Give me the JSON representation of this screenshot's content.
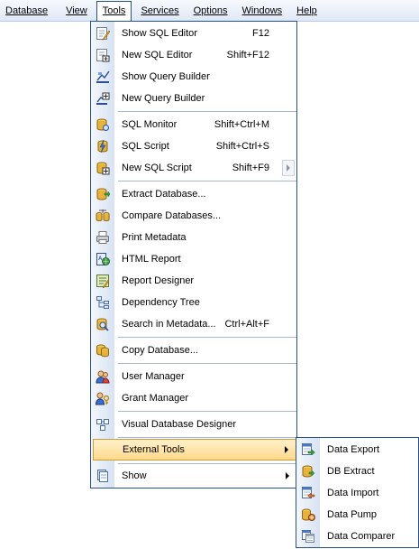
{
  "menubar": {
    "items": [
      {
        "label": "Database",
        "mnemonic_index": 0
      },
      {
        "label": "View",
        "mnemonic_index": 0
      },
      {
        "label": "Tools",
        "mnemonic_index": 0
      },
      {
        "label": "Services",
        "mnemonic_index": 0
      },
      {
        "label": "Options",
        "mnemonic_index": 0
      },
      {
        "label": "Windows",
        "mnemonic_index": 0
      },
      {
        "label": "Help",
        "mnemonic_index": 0
      }
    ],
    "open_item": "Tools"
  },
  "tools_menu": {
    "items": [
      {
        "label": "Show SQL Editor",
        "shortcut": "F12",
        "icon": "sql-editor-icon"
      },
      {
        "label": "New SQL Editor",
        "shortcut": "Shift+F12",
        "icon": "new-sql-editor-icon"
      },
      {
        "label": "Show Query Builder",
        "shortcut": "",
        "icon": "query-builder-icon"
      },
      {
        "label": "New Query Builder",
        "shortcut": "",
        "icon": "new-query-builder-icon"
      },
      {
        "label": "SQL Monitor",
        "shortcut": "Shift+Ctrl+M",
        "icon": "sql-monitor-icon"
      },
      {
        "label": "SQL Script",
        "shortcut": "Shift+Ctrl+S",
        "icon": "sql-script-icon"
      },
      {
        "label": "New SQL Script",
        "shortcut": "Shift+F9",
        "icon": "new-sql-script-icon",
        "has_submenu": true
      },
      {
        "label": "Extract Database...",
        "shortcut": "",
        "icon": "extract-database-icon"
      },
      {
        "label": "Compare Databases...",
        "shortcut": "",
        "icon": "compare-databases-icon"
      },
      {
        "label": "Print Metadata",
        "shortcut": "",
        "icon": "printer-icon"
      },
      {
        "label": "HTML Report",
        "shortcut": "",
        "icon": "html-report-icon"
      },
      {
        "label": "Report Designer",
        "shortcut": "",
        "icon": "report-designer-icon"
      },
      {
        "label": "Dependency Tree",
        "shortcut": "",
        "icon": "dependency-tree-icon"
      },
      {
        "label": "Search in Metadata...",
        "shortcut": "Ctrl+Alt+F",
        "icon": "search-metadata-icon"
      },
      {
        "label": "Copy Database...",
        "shortcut": "",
        "icon": "copy-database-icon"
      },
      {
        "label": "User Manager",
        "shortcut": "",
        "icon": "user-manager-icon"
      },
      {
        "label": "Grant Manager",
        "shortcut": "",
        "icon": "grant-manager-icon"
      },
      {
        "label": "Visual Database Designer",
        "shortcut": "",
        "icon": "visual-designer-icon"
      },
      {
        "label": "External Tools",
        "shortcut": "",
        "icon": "",
        "has_submenu": true,
        "highlighted": true
      },
      {
        "label": "Show",
        "shortcut": "",
        "icon": "show-icon",
        "has_submenu": true
      }
    ]
  },
  "external_tools_submenu": {
    "items": [
      {
        "label": "Data Export",
        "icon": "data-export-icon"
      },
      {
        "label": "DB Extract",
        "icon": "db-extract-icon"
      },
      {
        "label": "Data Import",
        "icon": "data-import-icon"
      },
      {
        "label": "Data Pump",
        "icon": "data-pump-icon"
      },
      {
        "label": "Data Comparer",
        "icon": "data-comparer-icon"
      }
    ]
  },
  "colors": {
    "menu_border": "#2a4f8e",
    "highlight_top": "#fff1cc",
    "highlight_bottom": "#ffd98a",
    "highlight_border": "#d29c33",
    "separator": "#a7b7d2"
  }
}
